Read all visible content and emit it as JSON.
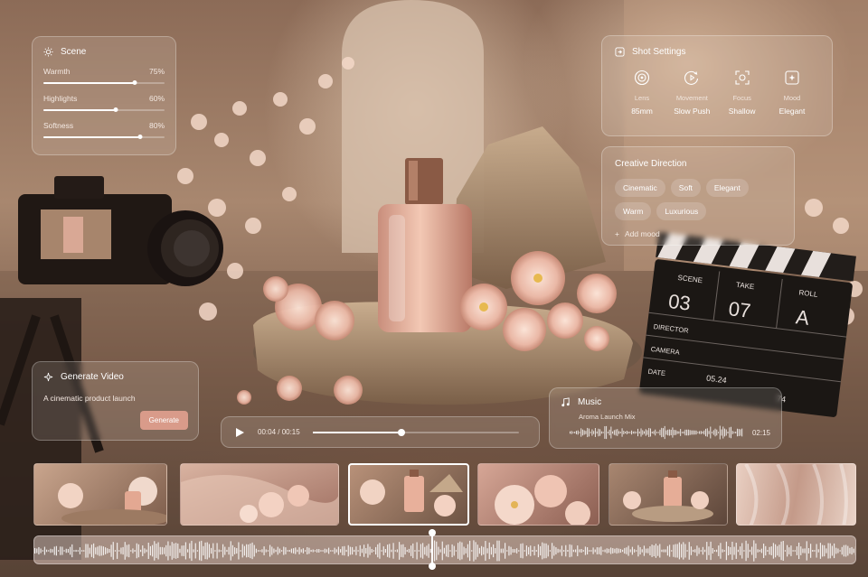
{
  "scene": {
    "title": "Scene",
    "icon": "sun-icon",
    "sliders": [
      {
        "label": "Warmth",
        "value_text": "75%",
        "value": 0.75
      },
      {
        "label": "Highlights",
        "value_text": "60%",
        "value": 0.6
      },
      {
        "label": "Softness",
        "value_text": "80%",
        "value": 0.8
      }
    ]
  },
  "shot_settings": {
    "title": "Shot Settings",
    "items": [
      {
        "label": "Lens",
        "value": "85mm",
        "icon": "lens-icon"
      },
      {
        "label": "Movement",
        "value": "Slow Push",
        "icon": "movement-icon"
      },
      {
        "label": "Focus",
        "value": "Shallow",
        "icon": "focus-icon"
      },
      {
        "label": "Mood",
        "value": "Elegant",
        "icon": "mood-icon"
      }
    ]
  },
  "creative_direction": {
    "title": "Creative Direction",
    "chips": [
      "Cinematic",
      "Soft",
      "Elegant",
      "Warm",
      "Luxurious"
    ],
    "add_label": "Add mood"
  },
  "generate": {
    "title": "Generate Video",
    "prompt": "A cinematic product launch",
    "button": "Generate"
  },
  "player": {
    "time": "00:04 / 00:15",
    "progress": 0.43
  },
  "music": {
    "title": "Music",
    "track": "Aroma Launch Mix",
    "duration": "02:15"
  },
  "clapperboard": {
    "scene_label": "SCENE",
    "scene": "03",
    "take_label": "TAKE",
    "take": "07",
    "roll_label": "ROLL",
    "roll": "A",
    "director_label": "DIRECTOR",
    "camera_label": "CAMERA",
    "date_label": "DATE",
    "date": "05.24",
    "extra": "74"
  },
  "timeline": {
    "selected_frame": 3,
    "playhead": 0.485
  },
  "colors": {
    "accent": "#d99b8a",
    "panel": "rgba(255,245,238,.13)"
  }
}
